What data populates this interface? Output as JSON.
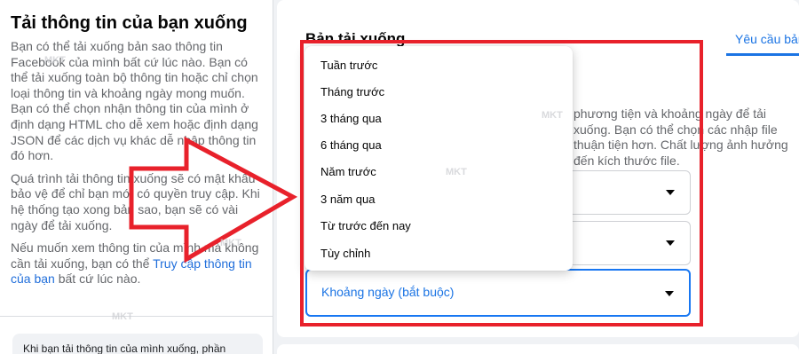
{
  "left": {
    "title": "Tải thông tin của bạn xuống",
    "para1": "Bạn có thể tải xuống bản sao thông tin Facebook của mình bất cứ lúc nào. Bạn có thể tải xuống toàn bộ thông tin hoặc chỉ chọn loại thông tin và khoảng ngày mong muốn. Bạn có thể chọn nhận thông tin của mình ở định dạng HTML cho dễ xem hoặc định dạng JSON để các dịch vụ khác dễ nhập thông tin đó hơn.",
    "para2": "Quá trình tải thông tin xuống sẽ có mật khẩu bảo vệ để chỉ bạn mới có quyền truy cập. Khi hệ thống tạo xong bản sao, bạn sẽ có vài ngày để tải xuống.",
    "para3_prefix": "Nếu muốn xem thông tin của mình mà không cần tải xuống, bạn có thể ",
    "para3_link": "Truy cập thông tin của bạn",
    "para3_suffix": " bất cứ lúc nào.",
    "note": "Khi bạn tải thông tin của mình xuống, phần"
  },
  "main": {
    "title": "Bản tải xuống",
    "tab": "Yêu cầu bản",
    "desc": "phương tiện và khoảng ngày để tải xuống. Bạn có thể chọn các nhập file thuận tiện hơn. Chất lượng ảnh hưởng đến kích thước file.",
    "select_placeholder": "Khoảng ngày (bắt buộc)"
  },
  "dropdown": {
    "items": [
      "Tuần trước",
      "Tháng trước",
      "3 tháng qua",
      "6 tháng qua",
      "Năm trước",
      "3 năm qua",
      "Từ trước đến nay",
      "Tùy chỉnh"
    ]
  },
  "watermark": "MKT",
  "colors": {
    "accent": "#1b74e4",
    "annotation_red": "#e8212b",
    "background": "#f0f2f5"
  }
}
